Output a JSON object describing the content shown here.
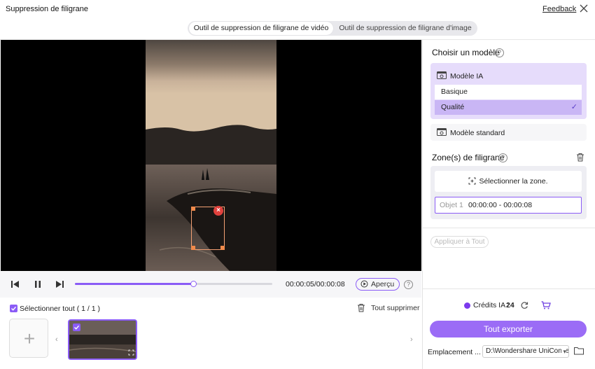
{
  "app": {
    "title": "Suppression de filigrane",
    "feedback": "Feedback"
  },
  "tabs": [
    {
      "label": "Outil de suppression de filigrane de vidéo",
      "active": true
    },
    {
      "label": "Outil de suppression de filigrane d'image",
      "active": false
    }
  ],
  "player": {
    "timecode": "00:00:05/00:00:08",
    "progress": 0.6,
    "preview_label": "Aperçu"
  },
  "file_list": {
    "select_all_label": "Sélectionner tout ( 1 / 1 )",
    "delete_all_label": "Tout supprimer",
    "add_symbol": "+"
  },
  "model": {
    "title": "Choisir un modèle",
    "ai_model_label": "Modèle IA",
    "options": [
      "Basique",
      "Qualité"
    ],
    "selected": "Qualité",
    "standard_label": "Modèle standard"
  },
  "zones": {
    "title": "Zone(s) de filigrane",
    "select_zone_label": "Sélectionner la zone.",
    "objects": [
      {
        "label": "Objet 1",
        "range": "00:00:00 - 00:00:08"
      }
    ],
    "apply_all_label": "Appliquer à Tout"
  },
  "footer": {
    "credits_label": "Crédits IA :",
    "credits_value": "24",
    "export_label": "Tout exporter",
    "location_label": "Emplacement ...",
    "location_value": "D:\\Wondershare UniConverter"
  },
  "colors": {
    "accent": "#8b5cf6",
    "accent_light": "#e6dcfb",
    "export_button": "#9b6cf6"
  }
}
